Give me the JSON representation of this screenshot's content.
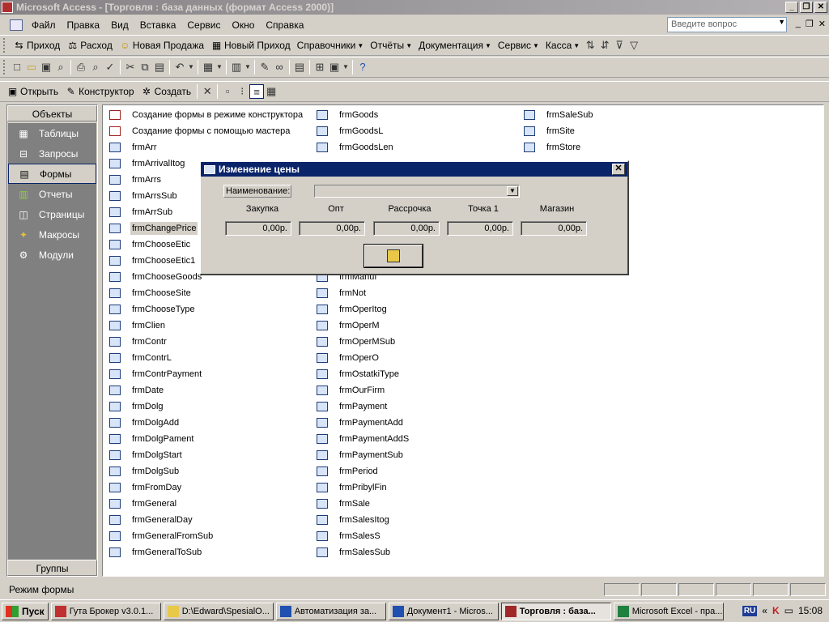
{
  "window": {
    "title": "Microsoft Access - [Торговля : база данных (формат Access 2000)]"
  },
  "menu": {
    "items": [
      "Файл",
      "Правка",
      "Вид",
      "Вставка",
      "Сервис",
      "Окно",
      "Справка"
    ],
    "ask_placeholder": "Введите вопрос"
  },
  "toolbar1": {
    "items": [
      "Приход",
      "Расход",
      "Новая Продажа",
      "Новый Приход",
      "Справочники",
      "Отчёты",
      "Документация",
      "Сервис",
      "Касса"
    ]
  },
  "dbtoolbar": {
    "open": "Открыть",
    "design": "Конструктор",
    "create": "Создать"
  },
  "objects": {
    "header": "Объекты",
    "items": [
      "Таблицы",
      "Запросы",
      "Формы",
      "Отчеты",
      "Страницы",
      "Макросы",
      "Модули"
    ],
    "groups": "Группы"
  },
  "files": {
    "col1": [
      "Создание формы в режиме конструктора",
      "Создание формы с помощью мастера",
      "frmArr",
      "frmArrivalItog",
      "frmArrs",
      "frmArrsSub",
      "frmArrSub",
      "frmChangePrice",
      "frmChooseEtic",
      "frmChooseEtic1",
      "frmChooseGoods",
      "frmChooseSite",
      "frmChooseType",
      "frmClien",
      "frmContr",
      "frmContrL",
      "frmContrPayment",
      "frmDate",
      "frmDolg",
      "frmDolgAdd",
      "frmDolgPament",
      "frmDolgStart",
      "frmDolgSub",
      "frmFromDay",
      "frmGeneral",
      "frmGeneralDay",
      "frmGeneralFromSub",
      "frmGeneralToSub"
    ],
    "col2": [
      "frmGoods",
      "frmGoodsL",
      "frmGoodsLen",
      "",
      "",
      "",
      "",
      "",
      "",
      "",
      "frmManuf",
      "frmNot",
      "frmOperItog",
      "frmOperM",
      "frmOperMSub",
      "frmOperO",
      "frmOstatkiType",
      "frmOurFirm",
      "frmPayment",
      "frmPaymentAdd",
      "frmPaymentAddS",
      "frmPaymentSub",
      "frmPeriod",
      "frmPribylFin",
      "frmSale",
      "frmSalesItog",
      "frmSalesS",
      "frmSalesSub"
    ],
    "col3": [
      "frmSaleSub",
      "frmSite",
      "frmStore"
    ]
  },
  "dialog": {
    "title": "Изменение цены",
    "name_label": "Наименование:",
    "name_value": "",
    "columns": [
      "Закупка",
      "Опт",
      "Рассрочка",
      "Точка 1",
      "Магазин"
    ],
    "values": [
      "0,00р.",
      "0,00р.",
      "0,00р.",
      "0,00р.",
      "0,00р."
    ]
  },
  "status": {
    "text": "Режим формы"
  },
  "taskbar": {
    "start": "Пуск",
    "tasks": [
      "Гута Брокер v3.0.1...",
      "D:\\Edward\\SpesialO...",
      "Автоматизация за...",
      "Документ1 - Micros...",
      "Торговля : база...",
      "Microsoft Excel - пра..."
    ],
    "lang": "RU",
    "clock": "15:08"
  }
}
